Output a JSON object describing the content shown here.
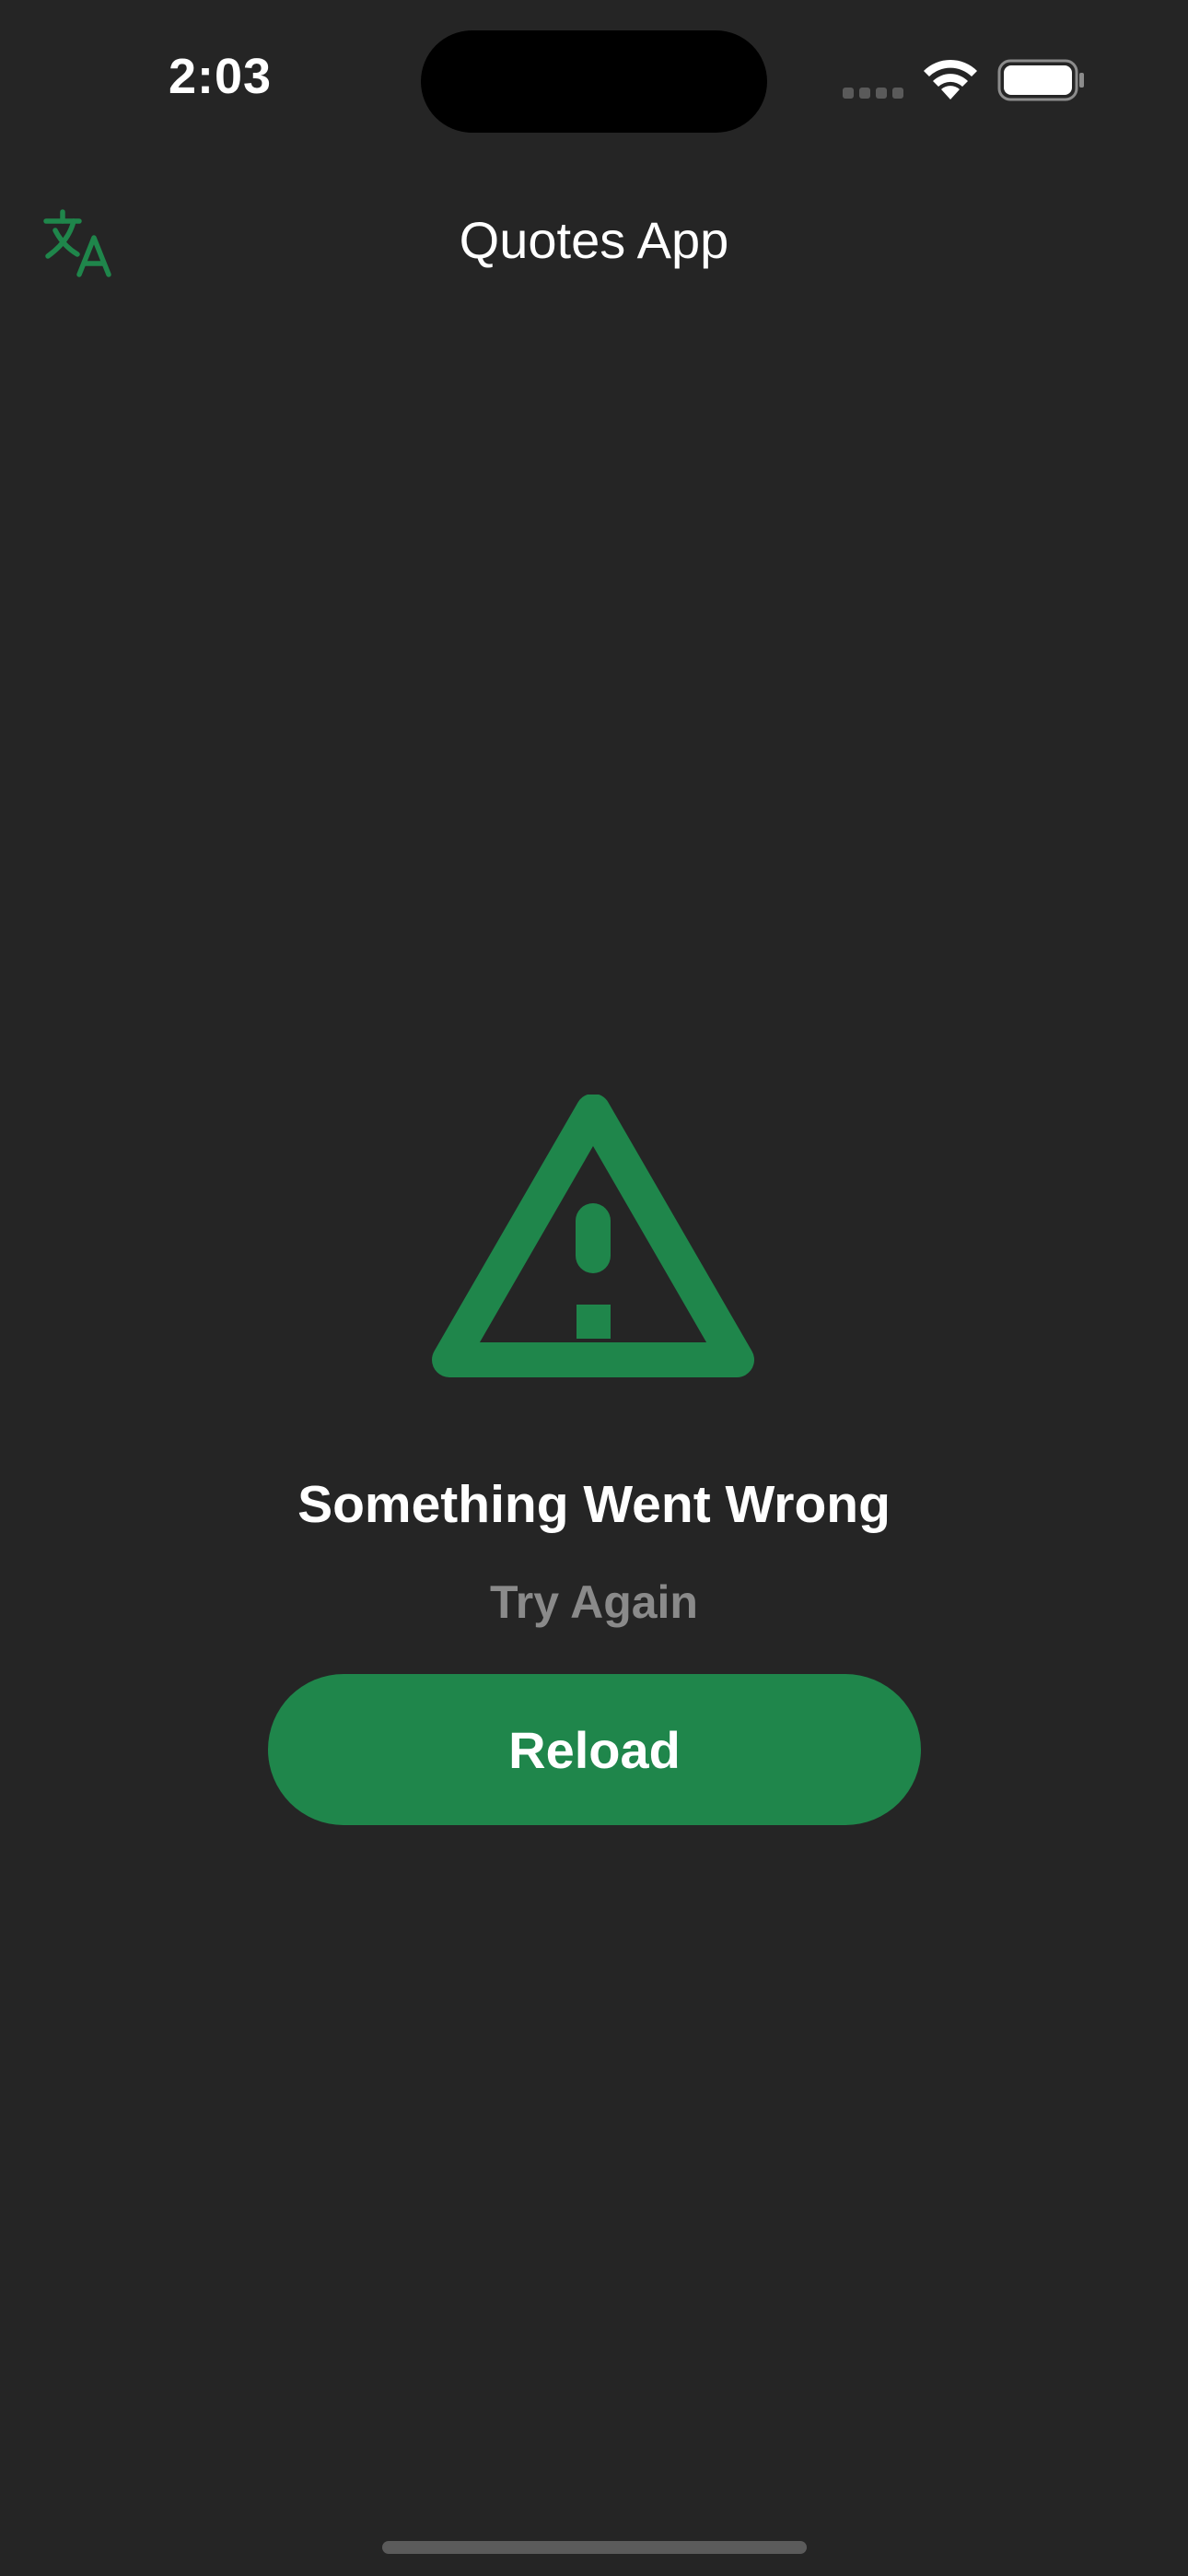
{
  "status_bar": {
    "time": "2:03",
    "wifi_icon": "wifi-icon",
    "battery_icon": "battery-icon",
    "signal_icon": "cellular-signal-icon"
  },
  "nav": {
    "title": "Quotes App",
    "translate_icon": "translate-icon"
  },
  "error": {
    "icon": "warning-icon",
    "title": "Something Went Wrong",
    "subtitle": "Try Again",
    "button_label": "Reload"
  },
  "colors": {
    "background": "#252525",
    "accent": "#1f864b",
    "subtitle": "#8a8a8a",
    "text": "#ffffff"
  }
}
